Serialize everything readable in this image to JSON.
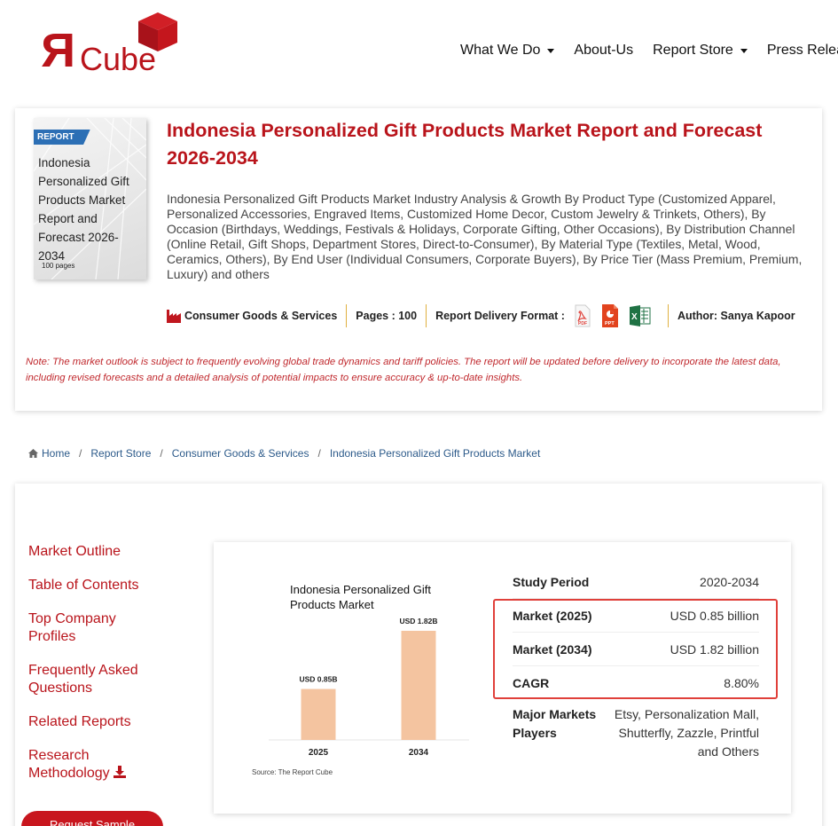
{
  "brand": {
    "logo_text": "Cube",
    "logo_letter": "R",
    "accent": "#b9141b"
  },
  "nav": {
    "items": [
      {
        "label": "What We Do",
        "dropdown": true
      },
      {
        "label": "About-Us",
        "dropdown": false
      },
      {
        "label": "Report Store",
        "dropdown": true
      },
      {
        "label": "Press Release",
        "dropdown": false
      }
    ]
  },
  "report": {
    "cover_tag": "REPORT",
    "cover_title": "Indonesia Personalized Gift Products Market Report and Forecast 2026-2034",
    "cover_pages": "100 pages",
    "title": "Indonesia Personalized Gift Products Market Report and Forecast 2026-2034",
    "description": "Indonesia Personalized Gift Products Market Industry Analysis & Growth By Product Type (Customized Apparel, Personalized Accessories, Engraved Items, Customized Home Decor, Custom Jewelry & Trinkets, Others), By Occasion (Birthdays, Weddings, Festivals & Holidays, Corporate Gifting, Other Occasions), By Distribution Channel (Online Retail, Gift Shops, Department Stores, Direct-to-Consumer), By Material Type (Textiles, Metal, Wood, Ceramics, Others), By End User (Individual Consumers, Corporate Buyers), By Price Tier (Mass Premium, Premium, Luxury) and others",
    "category": "Consumer Goods & Services",
    "pages": "Pages : 100",
    "delivery_label": "Report Delivery Format :",
    "formats": [
      "pdf-icon",
      "ppt-icon",
      "excel-icon"
    ],
    "author": "Author: Sanya Kapoor",
    "note": "Note: The market outlook is subject to frequently evolving global trade dynamics and tariff policies. The report will be updated before delivery to incorporate the latest data, including revised forecasts and a detailed analysis of potential impacts to ensure accuracy & up-to-date insights."
  },
  "breadcrumb": [
    "Home",
    "Report Store",
    "Consumer Goods & Services",
    "Indonesia Personalized Gift Products Market"
  ],
  "side_nav": {
    "items": [
      "Market Outline",
      "Table of Contents",
      "Top Company Profiles",
      "Frequently Asked Questions",
      "Related Reports",
      "Research Methodology"
    ],
    "sample_button": "Request Sample"
  },
  "summary": {
    "rows": [
      {
        "label": "Study Period",
        "value": "2020-2034"
      },
      {
        "label": "Market (2025)",
        "value": "USD 0.85 billion"
      },
      {
        "label": "Market (2034)",
        "value": "USD 1.82 billion"
      },
      {
        "label": "CAGR",
        "value": "8.80%"
      }
    ],
    "players_label": "Major Markets Players",
    "players_value": "Etsy, Personalization Mall, Shutterfly, Zazzle, Printful and Others"
  },
  "chart_data": {
    "type": "bar",
    "title": "Indonesia Personalized Gift Products Market",
    "categories": [
      "2025",
      "2034"
    ],
    "values": [
      0.85,
      1.82
    ],
    "data_labels": [
      "USD 0.85B",
      "USD 1.82B"
    ],
    "source": "Source: The Report Cube",
    "bar_color": "#f4c4a0",
    "ylim": [
      0,
      1.82
    ]
  }
}
